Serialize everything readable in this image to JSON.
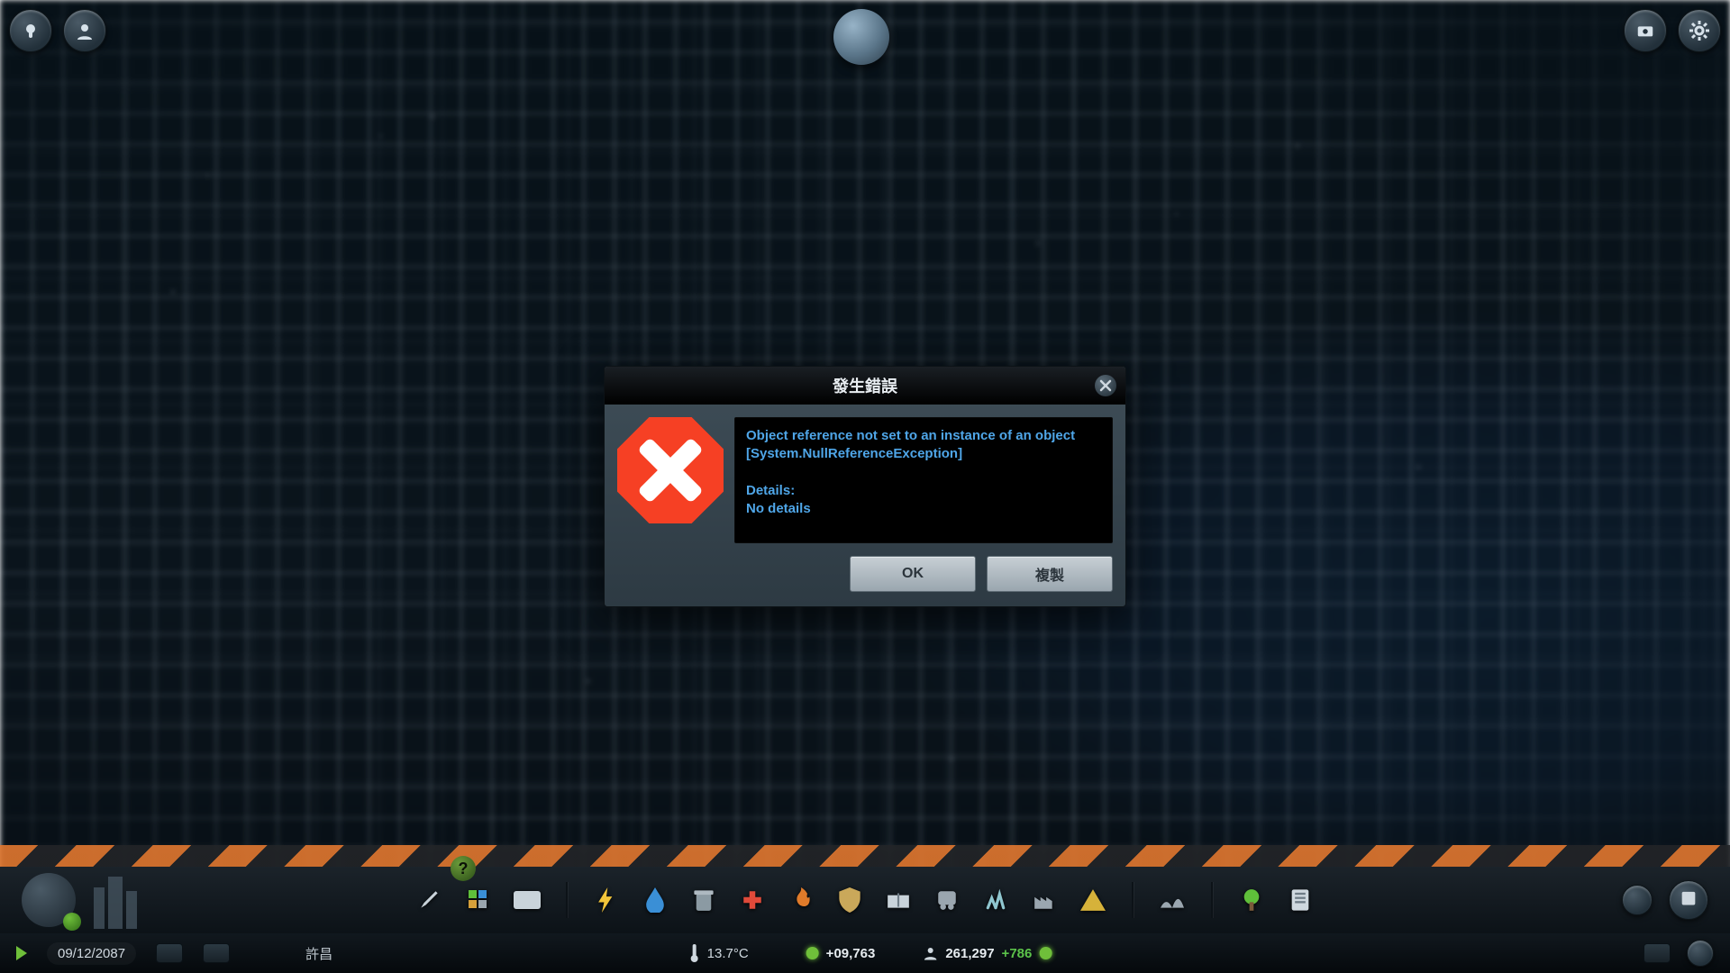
{
  "dialog": {
    "title": "發生錯誤",
    "error_line1": "Object reference not set to an instance of an object",
    "error_line2": "[System.NullReferenceException]",
    "details_label": "Details:",
    "details_value": "No details",
    "ok_label": "OK",
    "copy_label": "複製"
  },
  "status": {
    "date": "09/12/2087",
    "city_label": "許昌",
    "temperature": "13.7°C",
    "money": "+09,763",
    "population": "261,297",
    "pop_delta": "+786",
    "help_glyph": "?"
  },
  "toolbar_icons": [
    "brush-icon",
    "zones-icon",
    "districts-icon",
    "electricity-icon",
    "water-icon",
    "garbage-icon",
    "health-icon",
    "fire-icon",
    "police-icon",
    "education-icon",
    "transport-icon",
    "parks-icon",
    "industry-icon",
    "hazard-icon",
    "landscaping-icon",
    "tree-icon",
    "bulldoze-icon"
  ]
}
